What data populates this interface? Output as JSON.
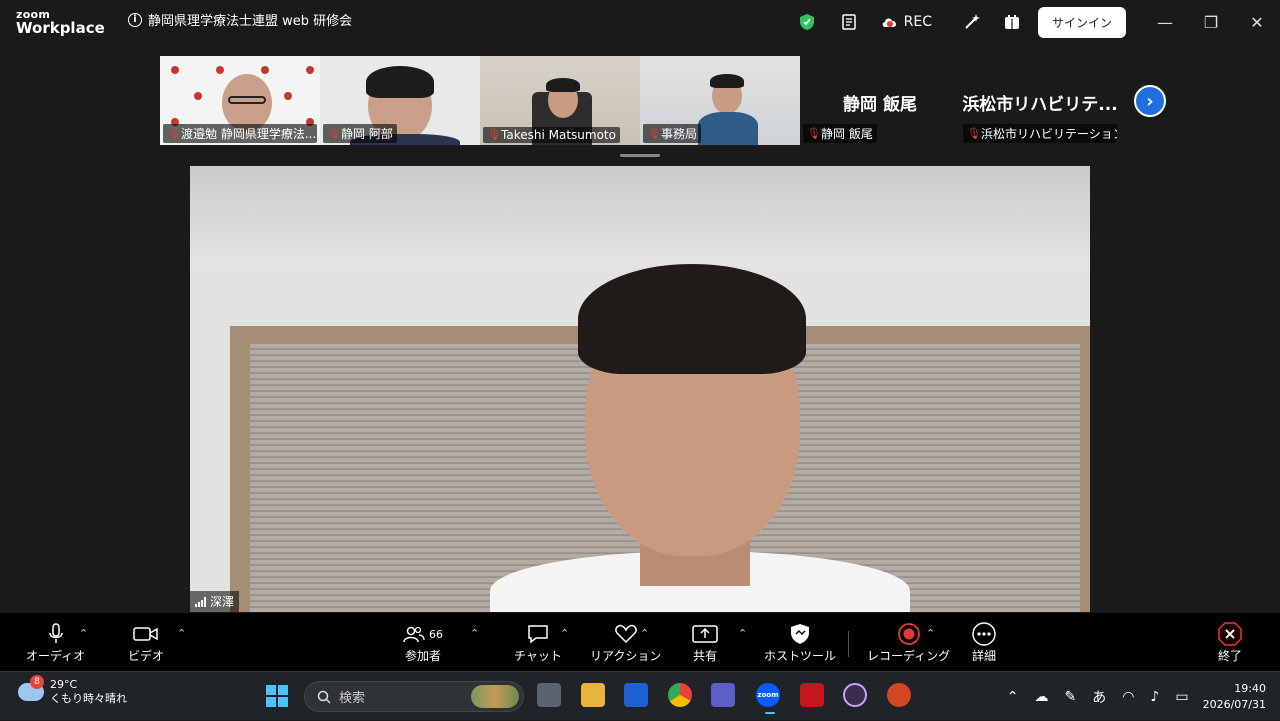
{
  "app": {
    "logo_line1": "zoom",
    "logo_line2": "Workplace"
  },
  "meeting": {
    "title": "静岡県理学療法士連盟 web 研修会"
  },
  "titlebar": {
    "rec_label": "REC",
    "signin_label": "サインイン"
  },
  "thumbnails": [
    {
      "name": "渡邉勉 静岡県理学療法..."
    },
    {
      "name": "静岡 阿部"
    },
    {
      "name": "Takeshi Matsumoto"
    },
    {
      "name": "事務局"
    },
    {
      "display": "静岡 飯尾",
      "name": "静岡 飯尾"
    },
    {
      "display": "浜松市リハビリテ...",
      "name": "浜松市リハビリテーション..."
    }
  ],
  "speaker": {
    "name": "深澤"
  },
  "toolbar": {
    "audio": "オーディオ",
    "video": "ビデオ",
    "participants": "参加者",
    "participants_count": "66",
    "chat": "チャット",
    "reactions": "リアクション",
    "share": "共有",
    "host_tools": "ホストツール",
    "recording": "レコーディング",
    "more": "詳細",
    "end": "終了"
  },
  "taskbar": {
    "weather_badge": "8",
    "temperature": "29°C",
    "condition": "くもり時々晴れ",
    "search_placeholder": "検索",
    "time": "19:40",
    "date": "2026/07/31",
    "ime": "あ"
  },
  "colors": {
    "accent": "#1f6fe0",
    "mic_off": "#e03c3c",
    "record": "#e03c3c",
    "shield": "#2fc35b"
  }
}
